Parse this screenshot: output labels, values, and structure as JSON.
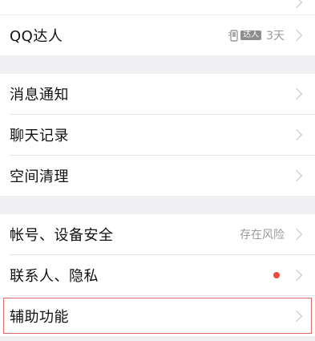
{
  "rows": [
    {
      "label": "QQ达人",
      "badge": "达人",
      "right_text": "3天"
    },
    {
      "label": "消息通知"
    },
    {
      "label": "聊天记录"
    },
    {
      "label": "空间清理"
    },
    {
      "label": "帐号、设备安全",
      "right_text": "存在风险"
    },
    {
      "label": "联系人、隐私"
    },
    {
      "label": "辅助功能"
    }
  ],
  "colors": {
    "background": "#f0f0f2",
    "row_bg": "#ffffff",
    "red_dot": "#f04a3a",
    "highlight_border": "#e26a6a"
  },
  "icons": {
    "chevron": "chevron-right-icon",
    "talent": "phone-wings-icon",
    "notification": "red-dot-icon"
  }
}
